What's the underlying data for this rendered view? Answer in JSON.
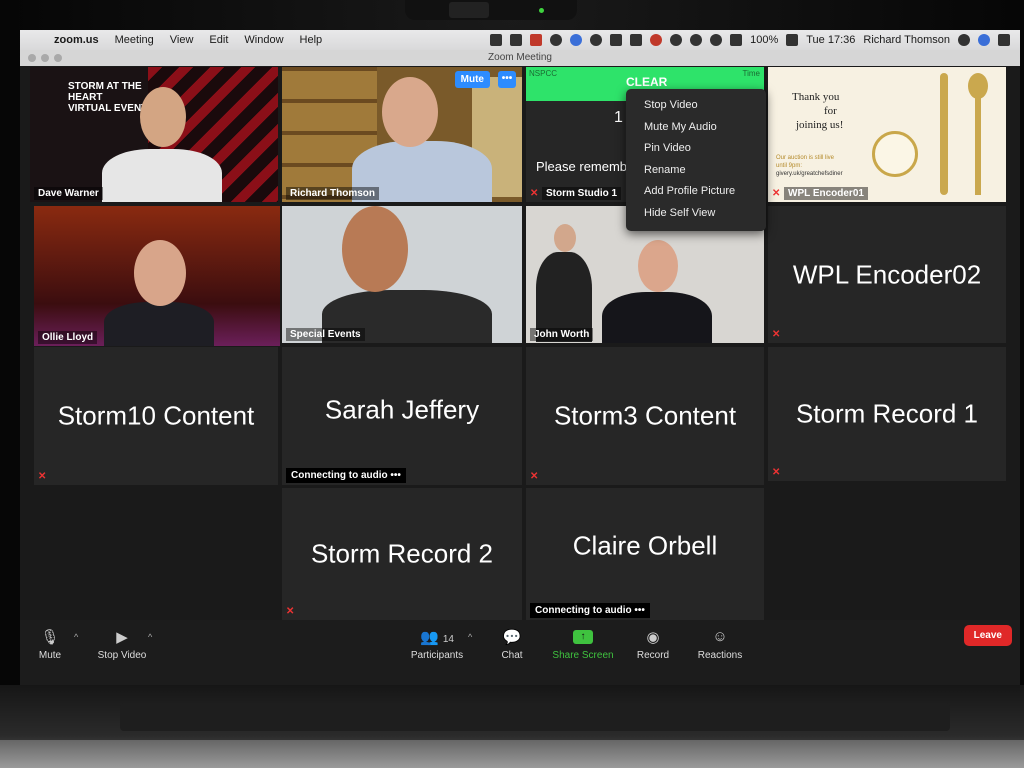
{
  "menubar": {
    "app": "zoom.us",
    "items": [
      "Meeting",
      "View",
      "Edit",
      "Window",
      "Help"
    ],
    "battery": "100%",
    "clock": "Tue 17:36",
    "user": "Richard Thomson"
  },
  "window": {
    "title": "Zoom Meeting"
  },
  "tiles": {
    "dave": {
      "name": "Dave Warner",
      "banner": "STORM AT THE HEART VIRTUAL EVENT"
    },
    "richard": {
      "name": "Richard Thomson",
      "mute": "Mute",
      "more": "•••"
    },
    "studio": {
      "name": "Storm Studio 1",
      "header": "CLEAR",
      "left_tag": "NSPCC",
      "right_tag": "Time",
      "digits": "1",
      "message": "Please rememb"
    },
    "wpl1": {
      "name": "WPL Encoder01",
      "line1": "Thank you",
      "line2": "for",
      "line3": "joining us!",
      "auction1": "Our auction is still live",
      "auction2": "until 9pm:",
      "auction3": "givery.uk/greatchefsdiner"
    },
    "ollie": {
      "name": "Ollie Lloyd"
    },
    "special": {
      "name": "Special Events"
    },
    "john": {
      "name": "John Worth"
    },
    "wpl2": {
      "name": "WPL Encoder02"
    },
    "storm10": {
      "name": "Storm10 Content"
    },
    "sarah": {
      "name": "Sarah Jeffery",
      "status": "Connecting to audio •••"
    },
    "storm3": {
      "name": "Storm3 Content"
    },
    "record1": {
      "name": "Storm Record 1"
    },
    "record2": {
      "name": "Storm Record 2"
    },
    "claire": {
      "name": "Claire Orbell",
      "status": "Connecting to audio •••"
    }
  },
  "context_menu": {
    "items": [
      "Stop Video",
      "Mute My Audio",
      "Pin Video",
      "Rename",
      "Add Profile Picture",
      "Hide Self View"
    ]
  },
  "toolbar": {
    "mute": "Mute",
    "stop_video": "Stop Video",
    "participants": "Participants",
    "participant_count": "14",
    "chat": "Chat",
    "share": "Share Screen",
    "record": "Record",
    "reactions": "Reactions",
    "leave": "Leave"
  },
  "colors": {
    "active_speaker": "#d4e34c",
    "share_green": "#3fc23f",
    "leave_red": "#e02828",
    "zoom_blue": "#2d8cff"
  }
}
